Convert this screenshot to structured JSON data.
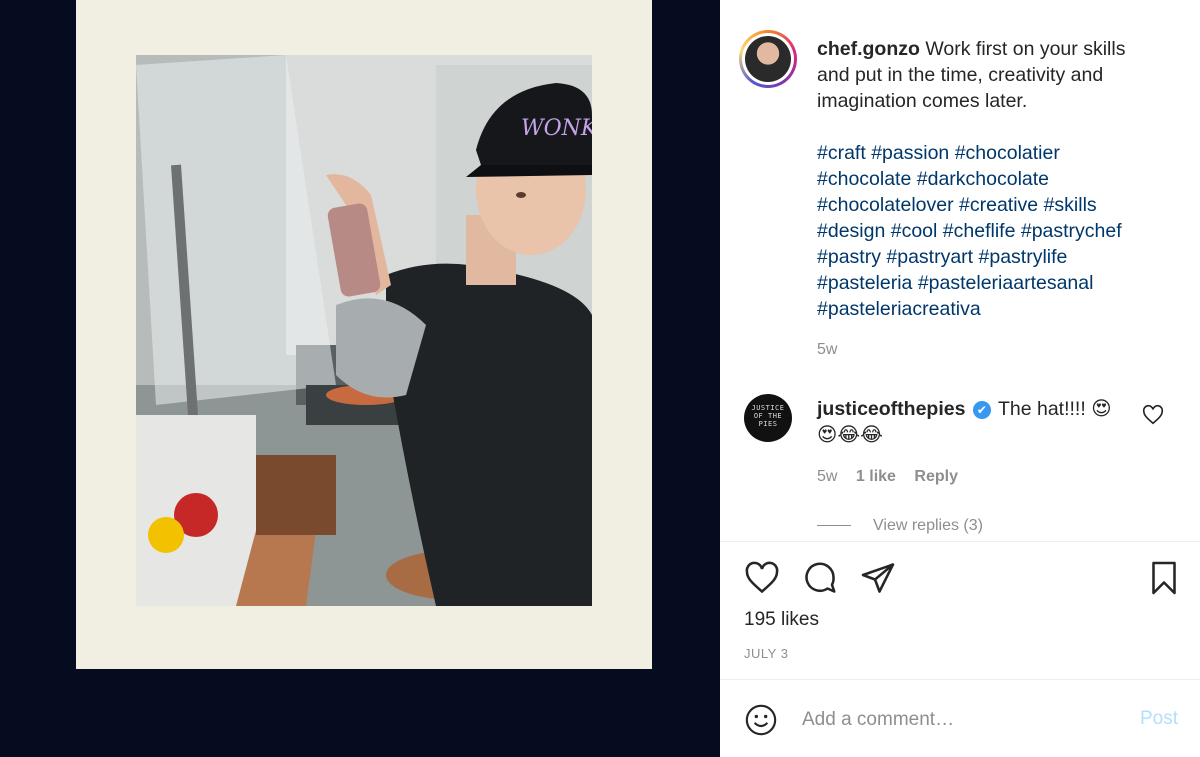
{
  "post": {
    "username": "chef.gonzo",
    "caption": "Work first on your skills and put in the time, creativity and imagination comes later.",
    "hashtags": [
      "#craft",
      "#passion",
      "#chocolatier",
      "#chocolate",
      "#darkchocolate",
      "#chocolatelover",
      "#creative",
      "#skills",
      "#design",
      "#cool",
      "#cheflife",
      "#pastrychef",
      "#pastry",
      "#pastryart",
      "#pastrylife",
      "#pasteleria",
      "#pasteleriaartesanal",
      "#pasteleriacreativa"
    ],
    "age": "5w",
    "likes": "195 likes",
    "date": "JULY 3"
  },
  "photo": {
    "hat_text": "WONKA"
  },
  "comment": {
    "avatar_text": [
      "JUSTICE",
      "OF THE",
      "PIES"
    ],
    "username": "justiceofthepies",
    "verified_mark": "✔",
    "text": "The hat!!!!",
    "emoji_1": "😍",
    "emoji_line": "😍😂😂",
    "age": "5w",
    "likes": "1 like",
    "reply_label": "Reply",
    "view_replies": "View replies (3)"
  },
  "composer": {
    "placeholder": "Add a comment…",
    "post_label": "Post"
  },
  "icons": {
    "like": "heart-icon",
    "comment": "comment-bubble-icon",
    "share": "paper-plane-icon",
    "save": "bookmark-icon",
    "emoji": "smiley-icon"
  },
  "colors": {
    "hashtag": "#00376b",
    "muted": "#8e8e8e",
    "post_button_disabled": "#b2dffc",
    "verified": "#3897f0"
  }
}
